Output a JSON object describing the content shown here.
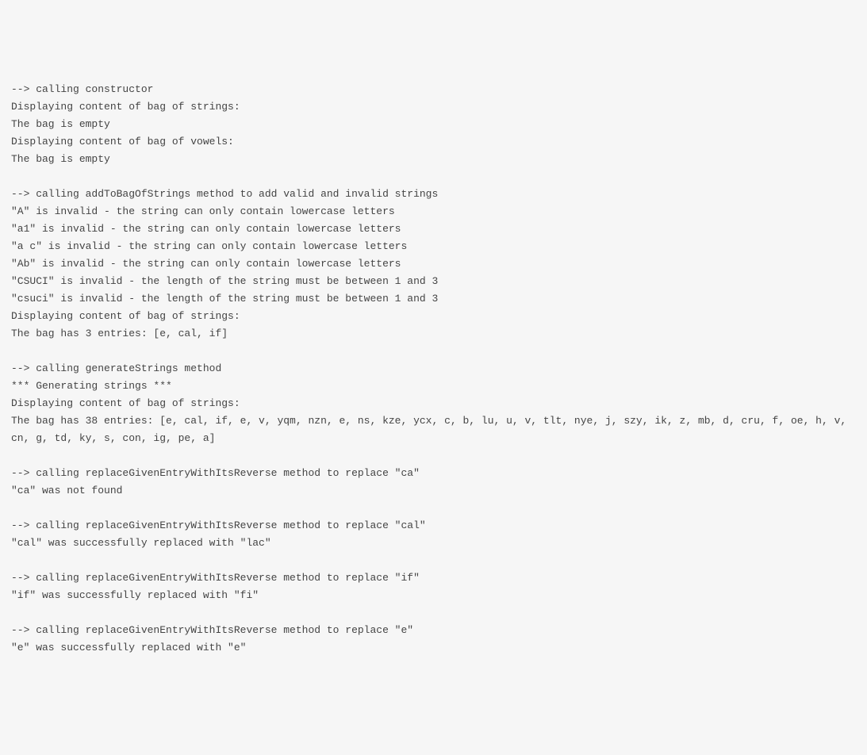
{
  "lines": [
    "--> calling constructor",
    "Displaying content of bag of strings:",
    "The bag is empty",
    "Displaying content of bag of vowels:",
    "The bag is empty",
    "",
    "--> calling addToBagOfStrings method to add valid and invalid strings",
    "\"A\" is invalid - the string can only contain lowercase letters",
    "\"a1\" is invalid - the string can only contain lowercase letters",
    "\"a c\" is invalid - the string can only contain lowercase letters",
    "\"Ab\" is invalid - the string can only contain lowercase letters",
    "\"CSUCI\" is invalid - the length of the string must be between 1 and 3",
    "\"csuci\" is invalid - the length of the string must be between 1 and 3",
    "Displaying content of bag of strings:",
    "The bag has 3 entries: [e, cal, if]",
    "",
    "--> calling generateStrings method",
    "*** Generating strings ***",
    "Displaying content of bag of strings:",
    "The bag has 38 entries: [e, cal, if, e, v, yqm, nzn, e, ns, kze, ycx, c, b, lu, u, v, tlt, nye, j, szy, ik, z, mb, d, cru, f, oe, h, v, cn, g, td, ky, s, con, ig, pe, a]",
    "",
    "--> calling replaceGivenEntryWithItsReverse method to replace \"ca\"",
    "\"ca\" was not found",
    "",
    "--> calling replaceGivenEntryWithItsReverse method to replace \"cal\"",
    "\"cal\" was successfully replaced with \"lac\"",
    "",
    "--> calling replaceGivenEntryWithItsReverse method to replace \"if\"",
    "\"if\" was successfully replaced with \"fi\"",
    "",
    "--> calling replaceGivenEntryWithItsReverse method to replace \"e\"",
    "\"e\" was successfully replaced with \"e\""
  ]
}
